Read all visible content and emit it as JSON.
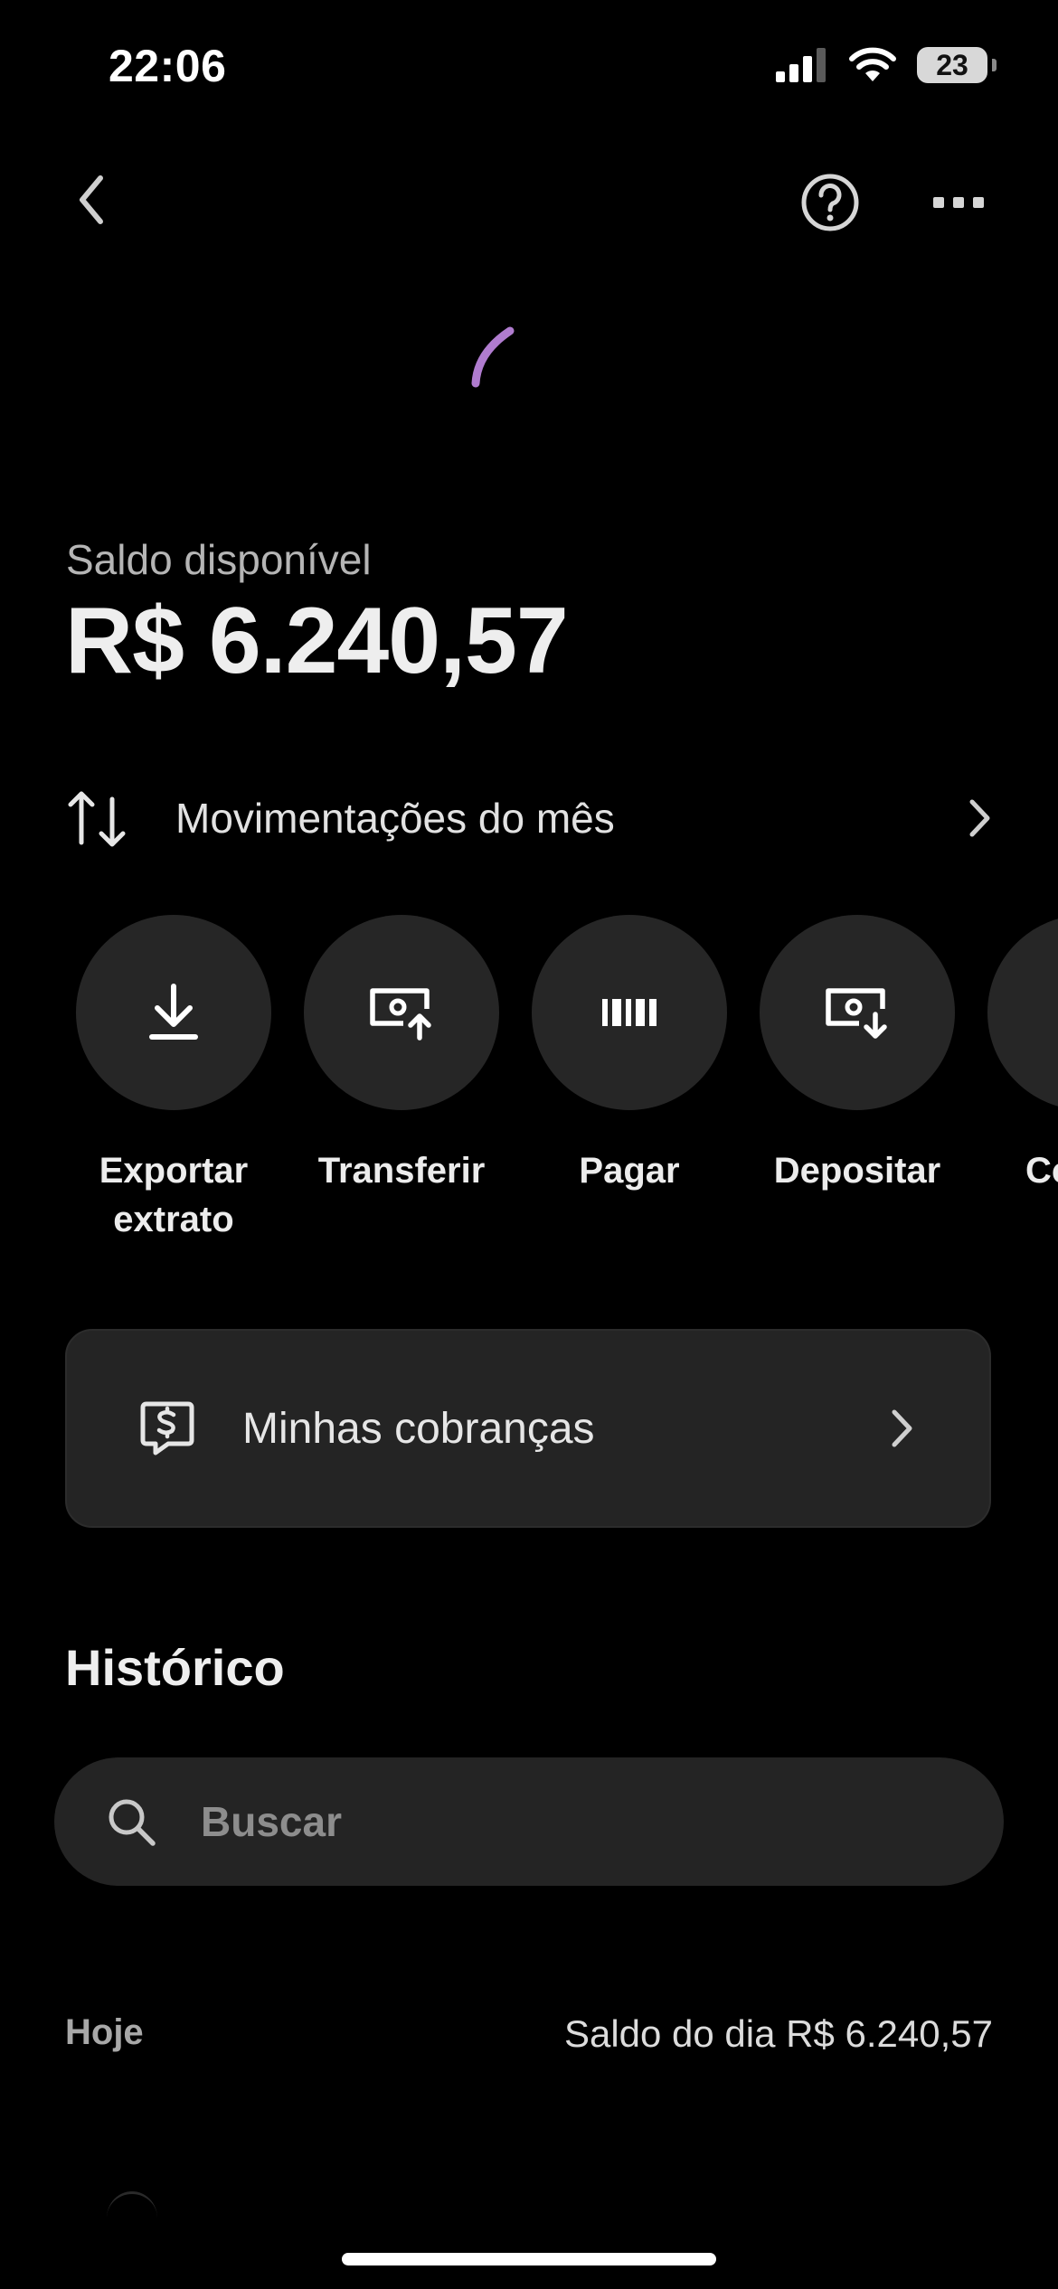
{
  "status_bar": {
    "time": "22:06",
    "battery": "23"
  },
  "balance": {
    "label": "Saldo disponível",
    "value": "R$ 6.240,57"
  },
  "movements": {
    "label": "Movimentações do mês"
  },
  "actions": [
    {
      "label": "Exportar extrato",
      "icon": "download-icon"
    },
    {
      "label": "Transferir",
      "icon": "money-send-icon"
    },
    {
      "label": "Pagar",
      "icon": "barcode-icon"
    },
    {
      "label": "Depositar",
      "icon": "money-receive-icon"
    },
    {
      "label": "Co",
      "icon": "unknown-icon"
    }
  ],
  "charges_card": {
    "label": "Minhas cobranças",
    "icon": "dollar-chat-icon"
  },
  "history": {
    "title": "Histórico",
    "search_placeholder": "Buscar",
    "day_label": "Hoje",
    "day_balance": "Saldo do dia R$ 6.240,57"
  },
  "colors": {
    "background": "#000000",
    "surface": "#242424",
    "accent_spinner": "#b07ccf",
    "text_primary": "#eeeeee",
    "text_secondary": "#b5b5b5"
  }
}
